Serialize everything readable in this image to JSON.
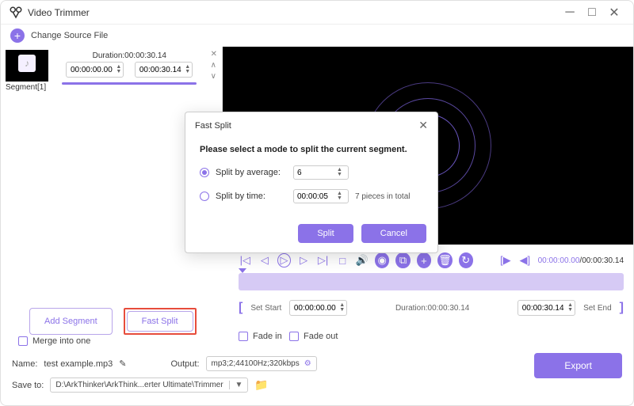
{
  "window": {
    "title": "Video Trimmer"
  },
  "toolbar": {
    "change_source": "Change Source File"
  },
  "segment": {
    "label": "Segment[1]",
    "duration_label": "Duration:00:00:30.14",
    "start": "00:00:00.00",
    "end": "00:00:30.14"
  },
  "player": {
    "current": "00:00:00.00",
    "total": "00:00:30.14"
  },
  "trim": {
    "set_start": "Set Start",
    "start_val": "00:00:00.00",
    "dur_label": "Duration:00:00:30.14",
    "end_val": "00:00:30.14",
    "set_end": "Set End"
  },
  "buttons": {
    "add_segment": "Add Segment",
    "fast_split": "Fast Split",
    "export": "Export"
  },
  "options": {
    "merge": "Merge into one",
    "fade_in": "Fade in",
    "fade_out": "Fade out"
  },
  "footer": {
    "name_label": "Name:",
    "name_val": "test example.mp3",
    "output_label": "Output:",
    "output_val": "mp3;2;44100Hz;320kbps",
    "saveto_label": "Save to:",
    "saveto_val": "D:\\ArkThinker\\ArkThink...erter Ultimate\\Trimmer"
  },
  "modal": {
    "title": "Fast Split",
    "instruction": "Please select a mode to split the current segment.",
    "avg_label": "Split by average:",
    "avg_val": "6",
    "time_label": "Split by time:",
    "time_val": "00:00:05",
    "note": "7 pieces in total",
    "split_btn": "Split",
    "cancel_btn": "Cancel"
  }
}
